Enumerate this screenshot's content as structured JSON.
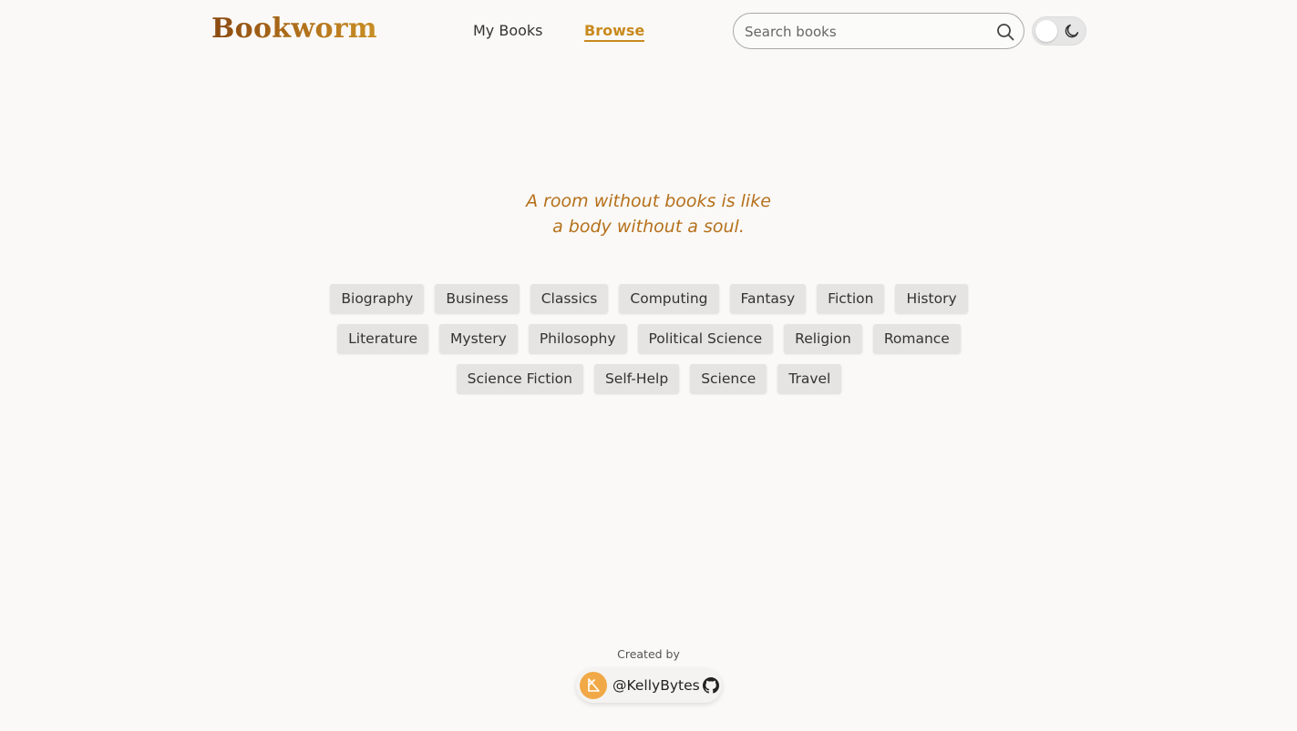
{
  "header": {
    "logo": "Bookworm",
    "nav": {
      "my_books": "My Books",
      "browse": "Browse"
    },
    "search": {
      "placeholder": "Search books",
      "value": ""
    },
    "theme_toggle": {
      "icon": "moon-icon",
      "state": "light"
    }
  },
  "main": {
    "quote_line1": "A room without books is like",
    "quote_line2": "a body without a soul.",
    "categories": [
      "Biography",
      "Business",
      "Classics",
      "Computing",
      "Fantasy",
      "Fiction",
      "History",
      "Literature",
      "Mystery",
      "Philosophy",
      "Political Science",
      "Religion",
      "Romance",
      "Science Fiction",
      "Self-Help",
      "Science",
      "Travel"
    ]
  },
  "footer": {
    "created_by": "Created by",
    "author": "@KellyBytes",
    "author_icon": "github-icon"
  },
  "colors": {
    "accent": "#c98a1e",
    "quote": "#b5701b",
    "background": "#faf9f7",
    "tag_bg": "#e5e4e2",
    "avatar": "#f1a947"
  }
}
